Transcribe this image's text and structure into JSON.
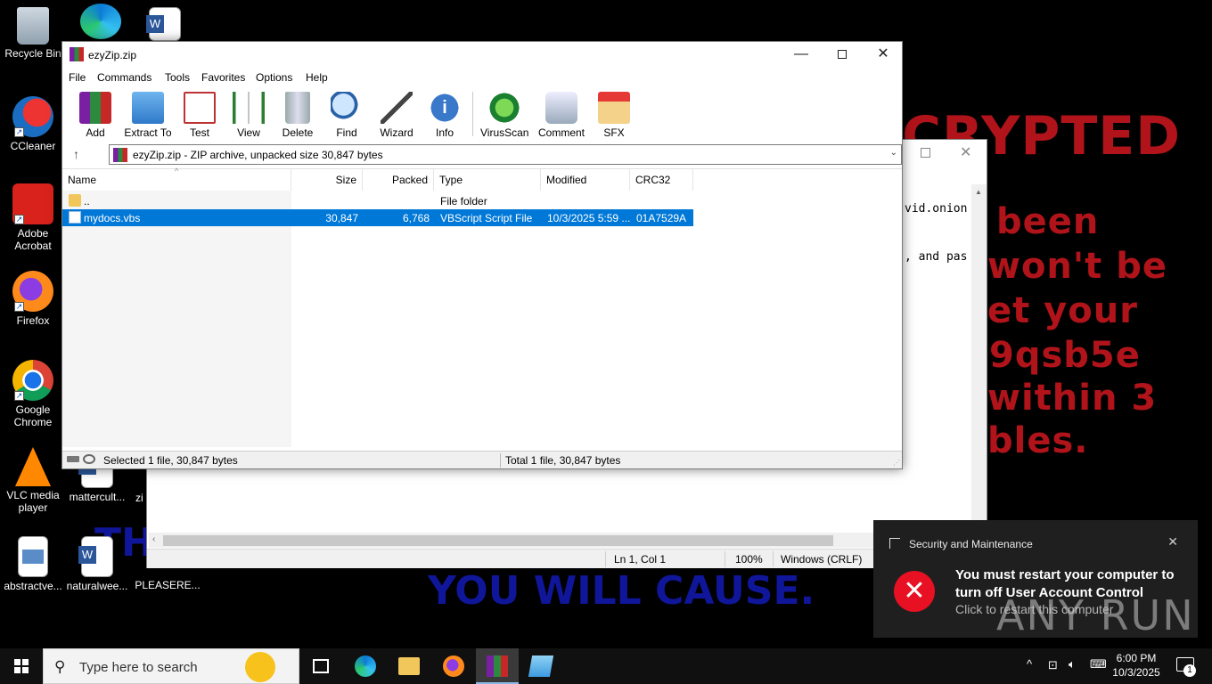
{
  "wallpaper": {
    "red_lines": [
      "CRYPTED",
      "been",
      "won't be",
      "et your",
      "9qsb5e",
      "within 3",
      "bles."
    ],
    "blue_lines": [
      "TH",
      "YOU WILL CAUSE."
    ]
  },
  "desktop_icons": [
    {
      "label": "Recycle Bin"
    },
    {
      "label": "CCleaner"
    },
    {
      "label": "Adobe Acrobat"
    },
    {
      "label": "Firefox"
    },
    {
      "label": "Google Chrome"
    },
    {
      "label": "VLC media player"
    },
    {
      "label": "mattercult..."
    },
    {
      "label": "zi"
    },
    {
      "label": "abstractve..."
    },
    {
      "label": "naturalwee..."
    },
    {
      "label": "PLEASERE..."
    }
  ],
  "notepad": {
    "line1": "vid.onion",
    "line2": ", and pas",
    "status": {
      "pos": "Ln 1, Col 1",
      "zoom": "100%",
      "eol": "Windows (CRLF)"
    }
  },
  "rar": {
    "title": "ezyZip.zip",
    "menu": [
      "File",
      "Commands",
      "Tools",
      "Favorites",
      "Options",
      "Help"
    ],
    "toolbar": [
      "Add",
      "Extract To",
      "Test",
      "View",
      "Delete",
      "Find",
      "Wizard",
      "Info",
      "VirusScan",
      "Comment",
      "SFX"
    ],
    "address": "ezyZip.zip - ZIP archive, unpacked size 30,847 bytes",
    "columns": [
      "Name",
      "Size",
      "Packed",
      "Type",
      "Modified",
      "CRC32"
    ],
    "rows": [
      {
        "name": "..",
        "size": "",
        "packed": "",
        "type": "File folder",
        "modified": "",
        "crc": ""
      },
      {
        "name": "mydocs.vbs",
        "size": "30,847",
        "packed": "6,768",
        "type": "VBScript Script File",
        "modified": "10/3/2025 5:59 ...",
        "crc": "01A7529A"
      }
    ],
    "status_left": "Selected 1 file, 30,847 bytes",
    "status_right": "Total 1 file, 30,847 bytes"
  },
  "toast": {
    "header": "Security and Maintenance",
    "message": "You must restart your computer to turn off User Account Control",
    "sub": "Click to restart this computer"
  },
  "watermark": "ANY RUN",
  "taskbar": {
    "search_placeholder": "Type here to search",
    "time": "6:00 PM",
    "date": "10/3/2025",
    "notif_count": "1"
  }
}
